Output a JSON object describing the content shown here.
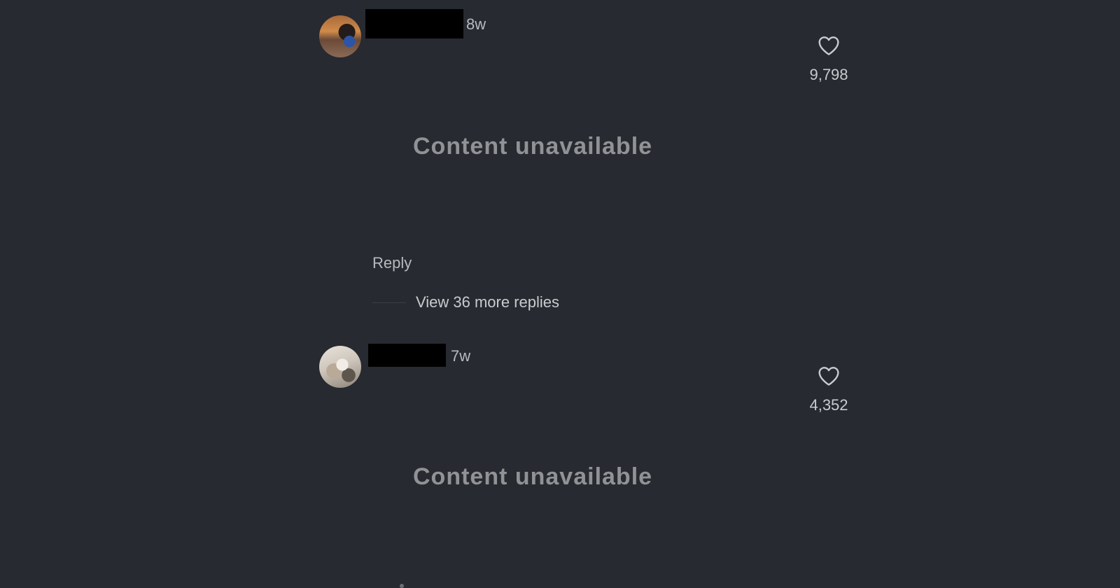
{
  "comments": [
    {
      "time": "8w",
      "content": "Content unavailable",
      "likes": "9,798",
      "reply_label": "Reply",
      "view_more_label": "View 36 more replies"
    },
    {
      "time": "7w",
      "content": "Content unavailable",
      "likes": "4,352"
    }
  ],
  "icons": {
    "like": "heart-outline-icon"
  },
  "colors": {
    "background": "#272a30",
    "text_primary": "#c9cbcf",
    "text_secondary": "#b8babe",
    "redaction": "#000000"
  }
}
